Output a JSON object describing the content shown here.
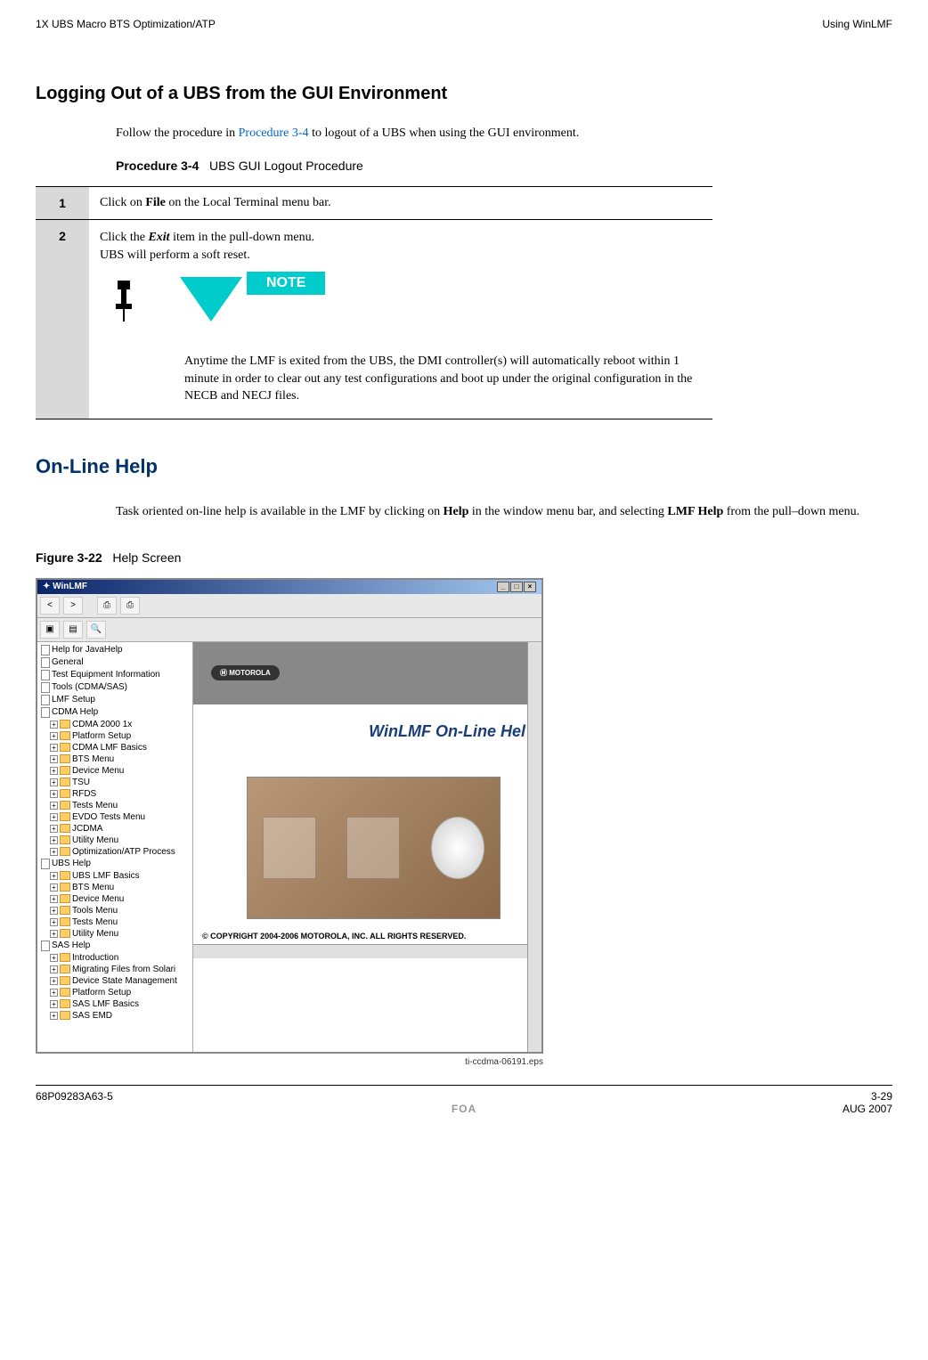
{
  "header": {
    "left": "1X UBS Macro BTS Optimization/ATP",
    "right": "Using WinLMF"
  },
  "section1": {
    "title": "Logging Out of a UBS from the GUI Environment",
    "intro_pre": "Follow the procedure in ",
    "intro_link": "Procedure 3-4",
    "intro_post": " to logout of a UBS when using the GUI environment.",
    "procedure_label": "Procedure 3-4",
    "procedure_name": "UBS GUI Logout Procedure"
  },
  "procedure": {
    "step1_num": "1",
    "step1_pre": "Click on ",
    "step1_bold": "File",
    "step1_post": " on the Local Terminal menu bar.",
    "step2_num": "2",
    "step2_pre": "Click the ",
    "step2_bold": "Exit",
    "step2_mid": " item in the pull-down menu.",
    "step2_line2": "UBS will perform a soft reset.",
    "note_label": "NOTE",
    "note_text": "Anytime the LMF is exited from the UBS, the DMI controller(s) will automatically reboot within 1 minute in order to clear out any test configurations and boot up under the original configuration in the NECB and NECJ files."
  },
  "section2": {
    "title": "On-Line Help",
    "body_pre": "Task oriented on-line help is available in the LMF by clicking on ",
    "body_bold1": "Help",
    "body_mid": " in the window menu bar, and selecting ",
    "body_bold2": "LMF Help",
    "body_post": " from the pull–down menu."
  },
  "figure": {
    "label": "Figure 3-22",
    "name": "Help Screen",
    "eps": "ti-ccdma-06191.eps"
  },
  "winlmf": {
    "title": "WinLMF",
    "content_title": "WinLMF On-Line Hel",
    "moto": "MOTOROLA",
    "copyright": "© COPYRIGHT 2004-2006 MOTOROLA, INC. ALL RIGHTS RESERVED.",
    "tree": {
      "n1": "Help for JavaHelp",
      "n2": "General",
      "n3": "Test Equipment Information",
      "n4": "Tools (CDMA/SAS)",
      "n5": "LMF Setup",
      "n6": "CDMA Help",
      "n6a": "CDMA 2000 1x",
      "n6b": "Platform Setup",
      "n6c": "CDMA LMF Basics",
      "n6d": "BTS Menu",
      "n6e": "Device Menu",
      "n6f": "TSU",
      "n6g": "RFDS",
      "n6h": "Tests Menu",
      "n6i": "EVDO Tests Menu",
      "n6j": "JCDMA",
      "n6k": "Utility Menu",
      "n6l": "Optimization/ATP Process",
      "n7": "UBS Help",
      "n7a": "UBS LMF Basics",
      "n7b": "BTS Menu",
      "n7c": "Device Menu",
      "n7d": "Tools Menu",
      "n7e": "Tests Menu",
      "n7f": "Utility Menu",
      "n8": "SAS Help",
      "n8a": "Introduction",
      "n8b": "Migrating Files from Solari",
      "n8c": "Device State Management",
      "n8d": "Platform Setup",
      "n8e": "SAS LMF Basics",
      "n8f": "SAS EMD"
    }
  },
  "footer": {
    "left": "68P09283A63-5",
    "right": "3-29",
    "center": "FOA",
    "date": "AUG 2007"
  }
}
